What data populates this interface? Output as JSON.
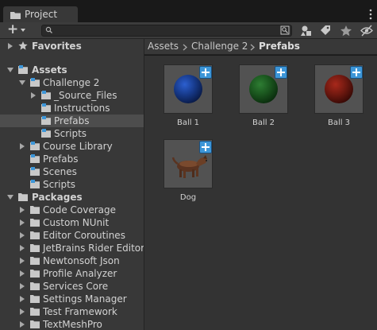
{
  "window": {
    "tab_label": "Project",
    "tab_icon": "folder-icon",
    "menu_icon": "kebab-menu-icon"
  },
  "toolbar": {
    "add_label": "+",
    "search_value": "",
    "icons": [
      "search-by-type-icon",
      "filter-by-type-icon",
      "filter-by-label-icon",
      "favorite-star-icon",
      "hidden-packages-icon"
    ]
  },
  "tree": {
    "favorites": "Favorites",
    "assets": "Assets",
    "challenge2": "Challenge 2",
    "source_files": "_Source_Files",
    "instructions": "Instructions",
    "prefabs_sel": "Prefabs",
    "scripts_c2": "Scripts",
    "course_library": "Course Library",
    "prefabs": "Prefabs",
    "scenes": "Scenes",
    "scripts": "Scripts",
    "packages": "Packages",
    "code_coverage": "Code Coverage",
    "custom_nunit": "Custom NUnit",
    "editor_coroutines": "Editor Coroutines",
    "jetbrains": "JetBrains Rider Editor",
    "newtonsoft": "Newtonsoft Json",
    "profile_analyzer": "Profile Analyzer",
    "services_core": "Services Core",
    "settings_manager": "Settings Manager",
    "test_framework": "Test Framework",
    "textmeshpro": "TextMeshPro"
  },
  "breadcrumb": {
    "assets": "Assets",
    "challenge2": "Challenge 2",
    "current": "Prefabs"
  },
  "assets": {
    "ball1": "Ball 1",
    "ball2": "Ball 2",
    "ball3": "Ball 3",
    "dog": "Dog"
  },
  "colors": {
    "selected_row": "#4d4d4d",
    "prefab_badge": "#3d96d8",
    "ball1": "#1a3c8c",
    "ball2": "#1b5a1f",
    "ball3": "#7a1a12"
  }
}
